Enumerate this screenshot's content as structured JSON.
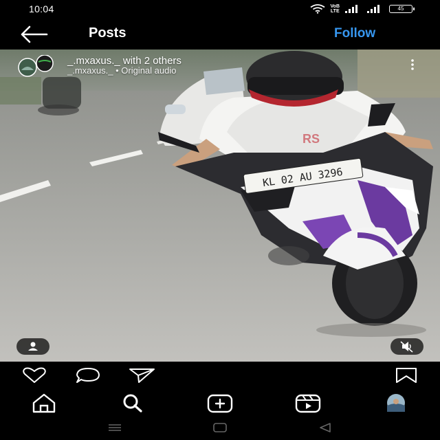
{
  "status_bar": {
    "time": "10:04",
    "network_label_top": "VoB",
    "network_label_bottom": "LTE",
    "battery": "45"
  },
  "header": {
    "back_icon": "arrow-left-icon",
    "title": "Posts",
    "follow_label": "Follow",
    "follow_color": "#3797f0"
  },
  "post": {
    "author_line": "_.mxaxus._ with 2 others",
    "audio_line": "_.mxaxus._ • Original audio",
    "more_icon": "more-vertical-icon",
    "license_plate": "KL 02 AU 3296",
    "fairing_text": "RS"
  },
  "overlays": {
    "tags_icon": "user-tag-icon",
    "mute_icon": "speaker-muted-icon"
  },
  "actions": {
    "like_icon": "heart-icon",
    "comment_icon": "comment-icon",
    "share_icon": "send-icon",
    "save_icon": "bookmark-icon"
  },
  "tabbar": {
    "home_icon": "home-icon",
    "search_icon": "search-icon",
    "create_icon": "plus-square-icon",
    "reels_icon": "reels-icon",
    "profile_icon": "profile-avatar"
  },
  "navbar": {
    "recents_icon": "recents-icon",
    "home_icon": "home-square-icon",
    "back_icon": "back-triangle-icon"
  }
}
